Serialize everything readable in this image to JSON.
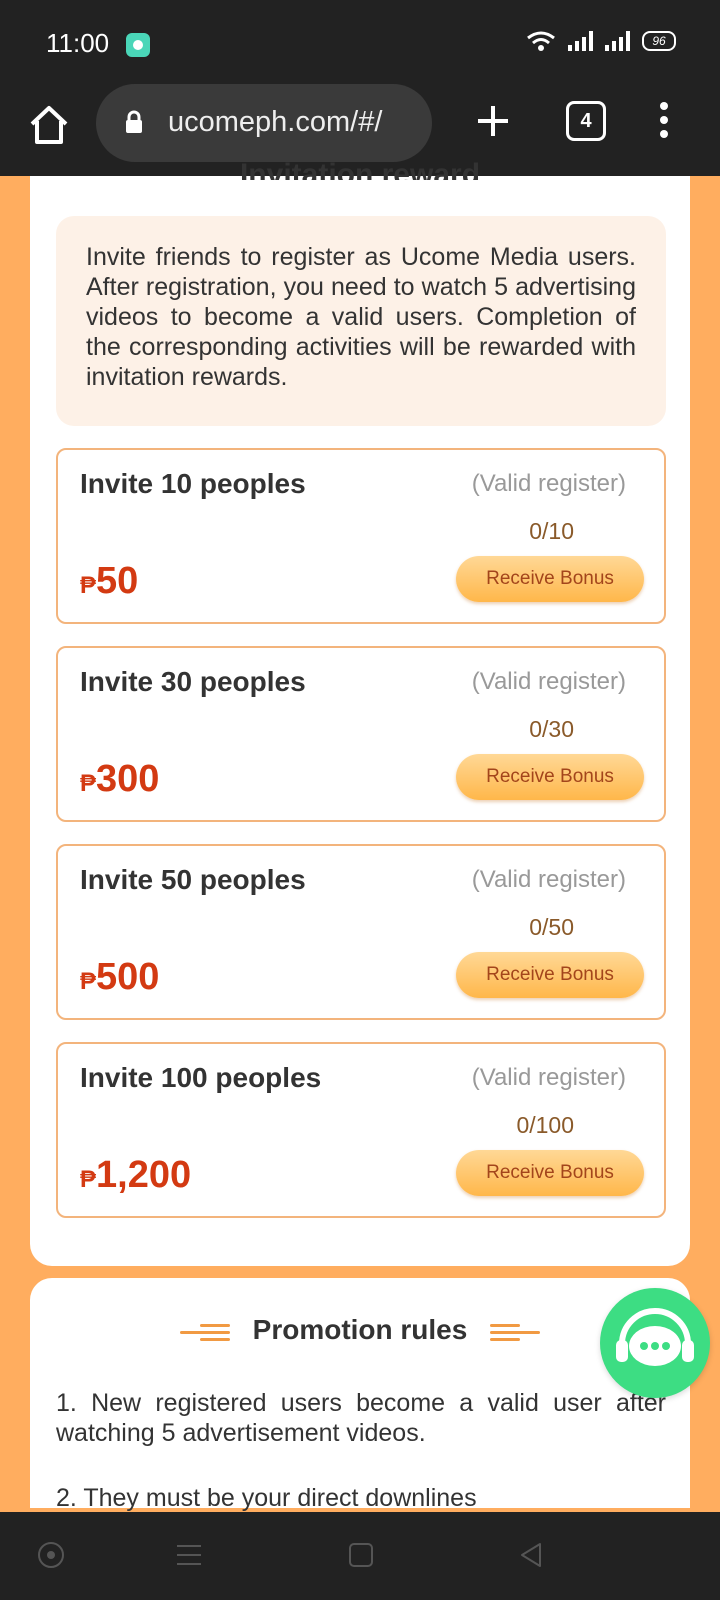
{
  "status_bar": {
    "time": "11:00",
    "battery": "96"
  },
  "browser": {
    "url": "ucomeph.com/#/",
    "tab_count": "4"
  },
  "card": {
    "title_fragment": "Invitation reward",
    "description": "Invite friends to register as Ucome Media users. After registration, you need to watch 5 advertising videos to become a valid users. Completion of the corresponding activities will be rewarded with invitation rewards.",
    "rewards": [
      {
        "title": "Invite 10 peoples",
        "valid_label": "(Valid register)",
        "progress": "0/10",
        "currency": "₱",
        "amount": "50",
        "button": "Receive Bonus"
      },
      {
        "title": "Invite 30 peoples",
        "valid_label": "(Valid register)",
        "progress": "0/30",
        "currency": "₱",
        "amount": "300",
        "button": "Receive Bonus"
      },
      {
        "title": "Invite 50 peoples",
        "valid_label": "(Valid register)",
        "progress": "0/50",
        "currency": "₱",
        "amount": "500",
        "button": "Receive Bonus"
      },
      {
        "title": "Invite 100 peoples",
        "valid_label": "(Valid register)",
        "progress": "0/100",
        "currency": "₱",
        "amount": "1,200",
        "button": "Receive Bonus"
      }
    ]
  },
  "promotion": {
    "title": "Promotion rules",
    "rules": [
      "1. New registered users become a valid user after watching 5 advertisement videos.",
      "2. They must be your direct downlines"
    ]
  },
  "colors": {
    "accent": "#ffad5f",
    "amount": "#d33a12",
    "chat": "#3ddd83"
  },
  "icons": [
    "home-icon",
    "lock-icon",
    "plus-icon",
    "tabs-icon",
    "more-vert-icon",
    "chat-support-icon"
  ]
}
